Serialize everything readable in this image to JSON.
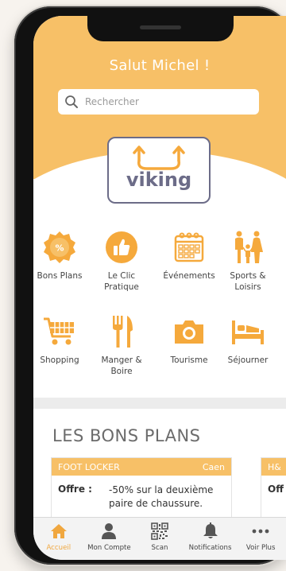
{
  "header": {
    "greeting": "Salut Michel !"
  },
  "search": {
    "placeholder": "Rechercher"
  },
  "logo": {
    "text": "viking"
  },
  "categories": [
    {
      "label": "Bons Plans",
      "icon": "percent-badge-icon"
    },
    {
      "label": "Le Clic\nPratique",
      "icon": "thumbs-up-icon"
    },
    {
      "label": "Événements",
      "icon": "calendar-icon"
    },
    {
      "label": "Sports &\nLoisirs",
      "icon": "family-icon"
    },
    {
      "label": "Shopping",
      "icon": "shopping-cart-icon"
    },
    {
      "label": "Manger &\nBoire",
      "icon": "fork-knife-icon"
    },
    {
      "label": "Tourisme",
      "icon": "camera-icon"
    },
    {
      "label": "Séjourner",
      "icon": "bed-icon"
    }
  ],
  "deals": {
    "title": "LES BONS PLANS",
    "cards": [
      {
        "store": "FOOT LOCKER",
        "city": "Caen",
        "offer_label": "Offre :",
        "offer": "-50% sur la deuxième\npaire de chaussure."
      },
      {
        "store": "H&",
        "city": "",
        "offer_label": "Off",
        "offer": ""
      }
    ]
  },
  "tabbar": [
    {
      "label": "Accueil",
      "icon": "home-icon",
      "active": true
    },
    {
      "label": "Mon Compte",
      "icon": "user-icon",
      "active": false
    },
    {
      "label": "Scan",
      "icon": "qr-code-icon",
      "active": false
    },
    {
      "label": "Notifications",
      "icon": "bell-icon",
      "active": false
    },
    {
      "label": "Voir Plus",
      "icon": "more-dots-icon",
      "active": false
    }
  ],
  "colors": {
    "accent": "#f7c067",
    "icon_orange": "#f5a93c",
    "logo": "#6c6c88"
  }
}
